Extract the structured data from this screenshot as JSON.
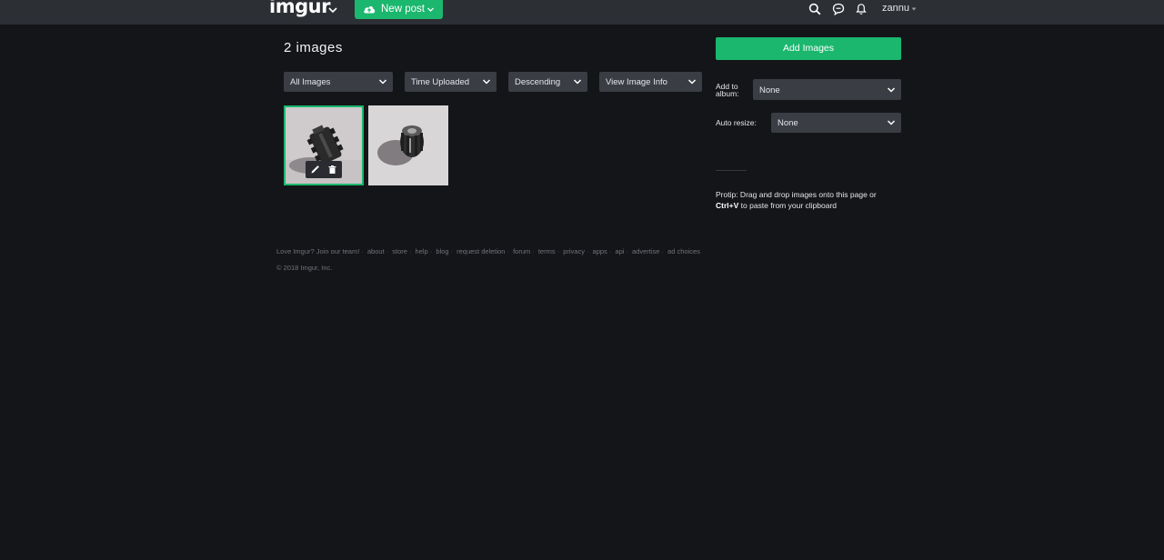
{
  "header": {
    "logo": "imgur",
    "new_post_label": "New post",
    "username": "zannu",
    "icons": [
      "search-icon",
      "chat-icon",
      "bell-icon",
      "chevron-down-icon"
    ]
  },
  "main": {
    "heading": "2 images",
    "filters": [
      {
        "value": "All Images"
      },
      {
        "value": "Time Uploaded"
      },
      {
        "value": "Descending"
      },
      {
        "value": "View Image Info"
      }
    ],
    "thumbnails": [
      {
        "selected": true,
        "icons": [
          "pencil-icon",
          "trash-icon"
        ]
      },
      {
        "selected": false
      }
    ]
  },
  "sidebar": {
    "add_images_label": "Add Images",
    "add_to_album_label_line1": "Add to",
    "add_to_album_label_line2": "album:",
    "album_value": "None",
    "auto_resize_label": "Auto resize:",
    "resize_value": "None",
    "protip_prefix": "Protip: Drag and drop images onto this page or",
    "protip_key": "Ctrl+V",
    "protip_suffix": "to paste from your clipboard"
  },
  "footer": {
    "links": [
      "Love Imgur? Join our team!",
      "about",
      "store",
      "help",
      "blog",
      "request deletion",
      "forum",
      "terms",
      "privacy",
      "apps",
      "api",
      "advertise",
      "ad choices"
    ],
    "copyright": "© 2018 Imgur, Inc."
  },
  "colors": {
    "background": "#141518",
    "topbar": "#2c2f34",
    "accent_green": "#1bb76e",
    "select_bg": "#3a3d43"
  }
}
